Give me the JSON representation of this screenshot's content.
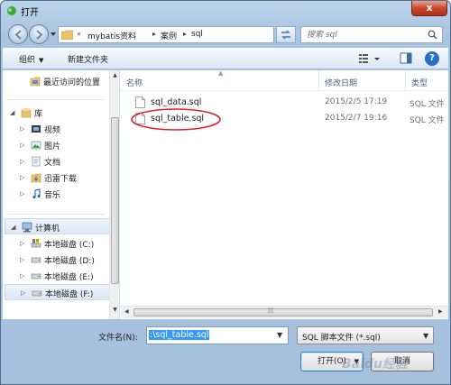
{
  "window": {
    "title": "打开",
    "close_label": "x"
  },
  "address": {
    "crumbs": [
      "«",
      "mybatis资料",
      "▸",
      "案例",
      "▸",
      "sql"
    ],
    "search_placeholder": "搜索 sql"
  },
  "toolbar": {
    "organize": "组织",
    "new_folder": "新建文件夹"
  },
  "nav": {
    "items": [
      {
        "label": "最近访问的位置"
      },
      {
        "label": "库"
      },
      {
        "label": "视频"
      },
      {
        "label": "图片"
      },
      {
        "label": "文档"
      },
      {
        "label": "迅雷下载"
      },
      {
        "label": "音乐"
      },
      {
        "label": "计算机"
      },
      {
        "label": "本地磁盘 (C:)"
      },
      {
        "label": "本地磁盘 (D:)"
      },
      {
        "label": "本地磁盘 (E:)"
      },
      {
        "label": "本地磁盘 (F:)"
      }
    ]
  },
  "columns": {
    "name": "名称",
    "date": "修改日期",
    "type": "类型"
  },
  "files": [
    {
      "name": "sql_data.sql",
      "date": "2015/2/5 17:19",
      "type": "SQL 文件"
    },
    {
      "name": "sql_table.sql",
      "date": "2015/2/7 19:16",
      "type": "SQL 文件"
    }
  ],
  "bottom": {
    "filename_label": "文件名(N):",
    "filename_value": ":\\sql_table.sql",
    "filetype_value": "SQL 脚本文件 (*.sql)",
    "open_label": "打开(O)",
    "cancel_label": "取消"
  },
  "watermark": "Baidu经验",
  "colors": {
    "accent": "#3399ff",
    "highlight_circle": "#e0202a",
    "title_bar": "#bcd3ea"
  }
}
